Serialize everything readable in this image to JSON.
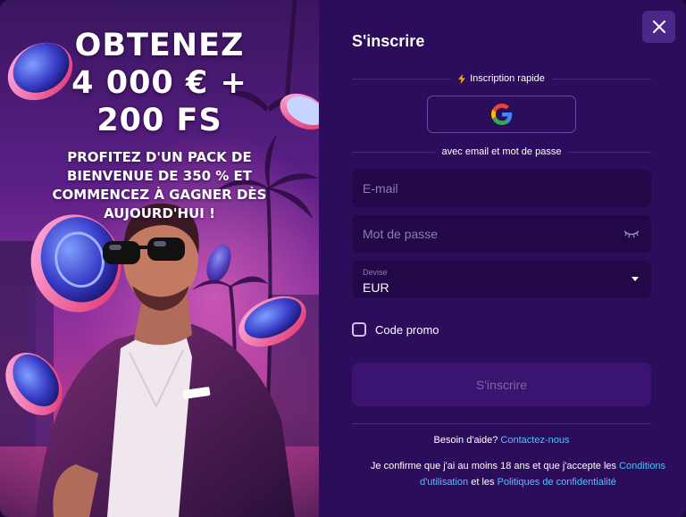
{
  "promo": {
    "headline_lines": [
      "OBTENEZ",
      "4 000 € +",
      "200 FS"
    ],
    "subtext_lines": [
      "PROFITEZ D'UN PACK DE",
      "BIENVENUE DE 350 % ET",
      "COMMENCEZ À GAGNER DÈS",
      "AUJOURD'HUI !"
    ]
  },
  "form": {
    "title": "S'inscrire",
    "quick_signup_label": "Inscription rapide",
    "google_icon": "google-g-icon",
    "email_password_label": "avec email et mot de passe",
    "email": {
      "placeholder": "E-mail",
      "value": ""
    },
    "password": {
      "placeholder": "Mot de passe",
      "value": ""
    },
    "currency": {
      "label": "Devise",
      "value": "EUR"
    },
    "promo_code_label": "Code promo",
    "submit_label": "S'inscrire",
    "help_text": "Besoin d'aide?",
    "help_link": "Contactez-nous",
    "legal_prefix": "Je confirme que j'ai au moins 18 ans et que j'accepte les",
    "legal_terms_link": "Conditions d'utilisation",
    "legal_and": "et les",
    "legal_privacy_link": "Politiques de confidentialité"
  },
  "colors": {
    "panel_bg": "#2c0d5c",
    "field_bg": "#220848",
    "link": "#4fc3ff",
    "close_bg": "#4a2788"
  }
}
